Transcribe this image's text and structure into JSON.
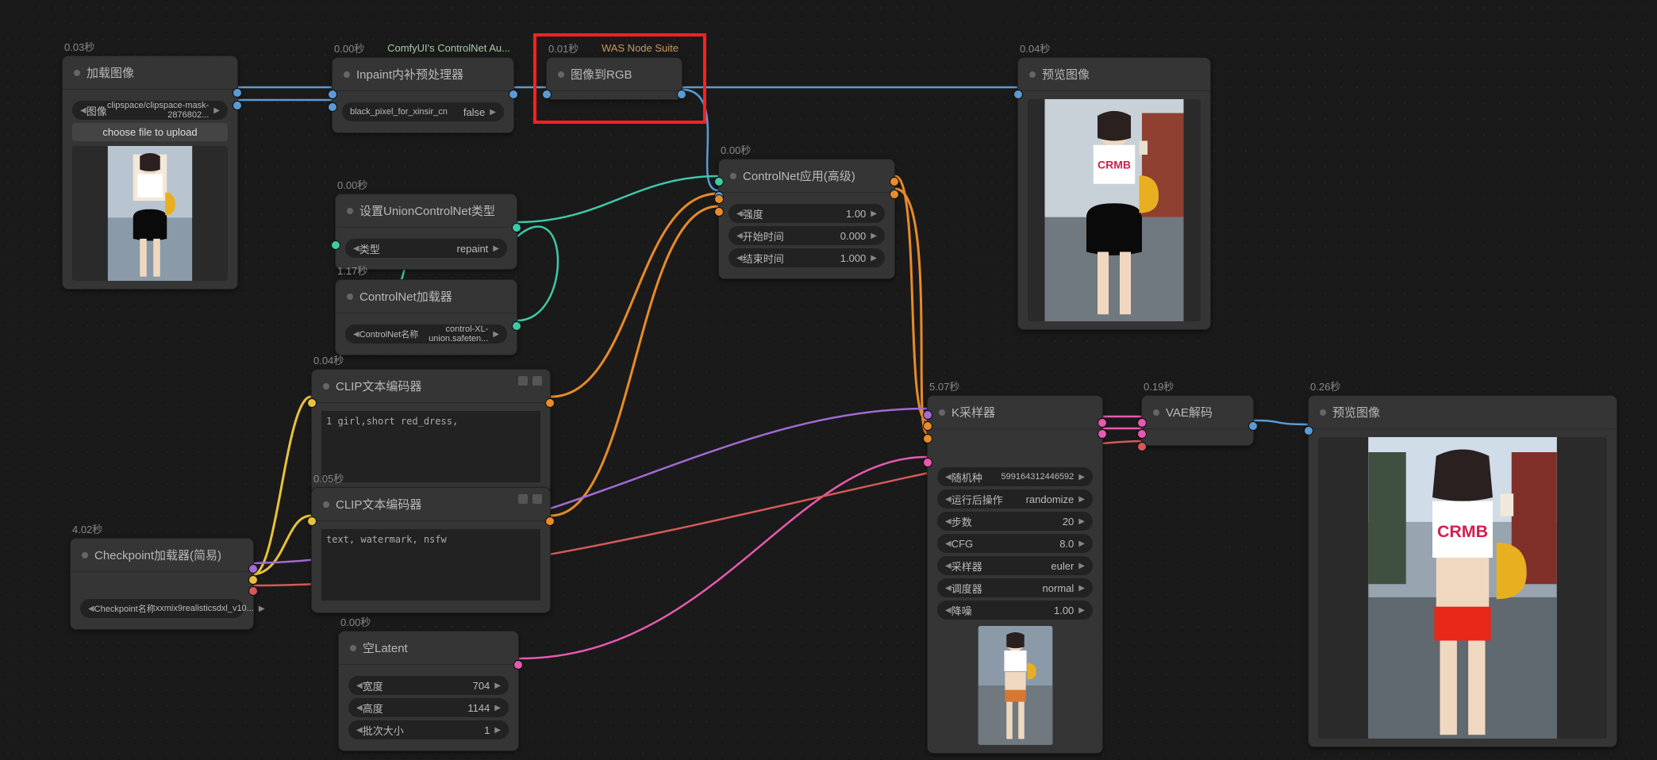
{
  "loadImage": {
    "time": "0.03秒",
    "title": "加载图像",
    "imgField": "图像",
    "imgValue": "clipspace/clipspace-mask-2876802...",
    "uploadBtn": "choose file to upload"
  },
  "inpaintPre": {
    "time": "0.00秒",
    "title": "Inpaint内补预处理器",
    "badge": "ComfyUI's ControlNet Au...",
    "field": "black_pixel_for_xinsir_cn",
    "value": "false"
  },
  "imageToRGB": {
    "time": "0.01秒",
    "title": "图像到RGB",
    "badge": "WAS Node Suite"
  },
  "setUnionType": {
    "time": "0.00秒",
    "title": "设置UnionControlNet类型",
    "label": "类型",
    "value": "repaint"
  },
  "cnLoader": {
    "time": "1.17秒",
    "title": "ControlNet加载器",
    "label": "ControlNet名称",
    "value": "control-XL-union.safeten..."
  },
  "cnApply": {
    "time": "0.00秒",
    "title": "ControlNet应用(高级)",
    "w": [
      {
        "label": "强度",
        "value": "1.00"
      },
      {
        "label": "开始时间",
        "value": "0.000"
      },
      {
        "label": "结束时间",
        "value": "1.000"
      }
    ]
  },
  "clipPos": {
    "time": "0.04秒",
    "title": "CLIP文本编码器",
    "text": "1 girl,short red_dress,"
  },
  "clipNeg": {
    "time": "0.05秒",
    "title": "CLIP文本编码器",
    "text": "text, watermark, nsfw"
  },
  "checkpoint": {
    "time": "4.02秒",
    "title": "Checkpoint加载器(简易)",
    "label": "Checkpoint名称",
    "value": "xxmix9realisticsdxl_v10..."
  },
  "emptyLatent": {
    "time": "0.00秒",
    "title": "空Latent",
    "w": [
      {
        "label": "宽度",
        "value": "704"
      },
      {
        "label": "高度",
        "value": "1144"
      },
      {
        "label": "批次大小",
        "value": "1"
      }
    ]
  },
  "ksampler": {
    "time": "5.07秒",
    "title": "K采样器",
    "w": [
      {
        "label": "随机种",
        "value": "599164312446592"
      },
      {
        "label": "运行后操作",
        "value": "randomize"
      },
      {
        "label": "步数",
        "value": "20"
      },
      {
        "label": "CFG",
        "value": "8.0"
      },
      {
        "label": "采样器",
        "value": "euler"
      },
      {
        "label": "调度器",
        "value": "normal"
      },
      {
        "label": "降噪",
        "value": "1.00"
      }
    ]
  },
  "vaeDecode": {
    "time": "0.19秒",
    "title": "VAE解码"
  },
  "preview1": {
    "time": "0.04秒",
    "title": "预览图像"
  },
  "preview2": {
    "time": "0.26秒",
    "title": "预览图像"
  }
}
